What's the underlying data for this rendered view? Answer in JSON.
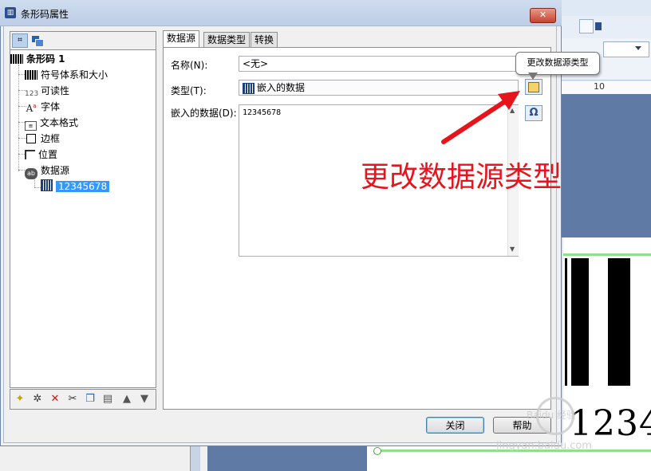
{
  "dialog": {
    "title": "条形码属性",
    "close_glyph": "✕"
  },
  "tree": {
    "root": "条形码 1",
    "items": [
      {
        "label": "符号体系和大小",
        "icon": "barcode-icon"
      },
      {
        "label": "可读性",
        "icon_text": "123"
      },
      {
        "label": "字体",
        "icon": "font-icon"
      },
      {
        "label": "文本格式",
        "icon": "text-format-icon"
      },
      {
        "label": "边框",
        "icon": "border-icon"
      },
      {
        "label": "位置",
        "icon": "position-icon"
      },
      {
        "label": "数据源",
        "icon": "data-source-icon"
      }
    ],
    "selected_child": "12345678"
  },
  "tabs": [
    {
      "label": "数据源",
      "active": true
    },
    {
      "label": "数据类型",
      "active": false
    },
    {
      "label": "转换",
      "active": false
    }
  ],
  "form": {
    "name_label": "名称(N):",
    "name_value": "<无>",
    "type_label": "类型(T):",
    "type_value": "嵌入的数据",
    "embedded_label": "嵌入的数据(D):",
    "embedded_value": "12345678"
  },
  "buttons": {
    "close": "关闭",
    "help": "帮助"
  },
  "tooltip": "更改数据源类型",
  "annotation": {
    "text": "更改数据源类型",
    "color": "#e8141b"
  },
  "background_app": {
    "ruler_mark": "10",
    "barcode_digits": "1234"
  },
  "watermark": {
    "text": "Baidu 经验",
    "url": "jingyan.baidu.com"
  }
}
